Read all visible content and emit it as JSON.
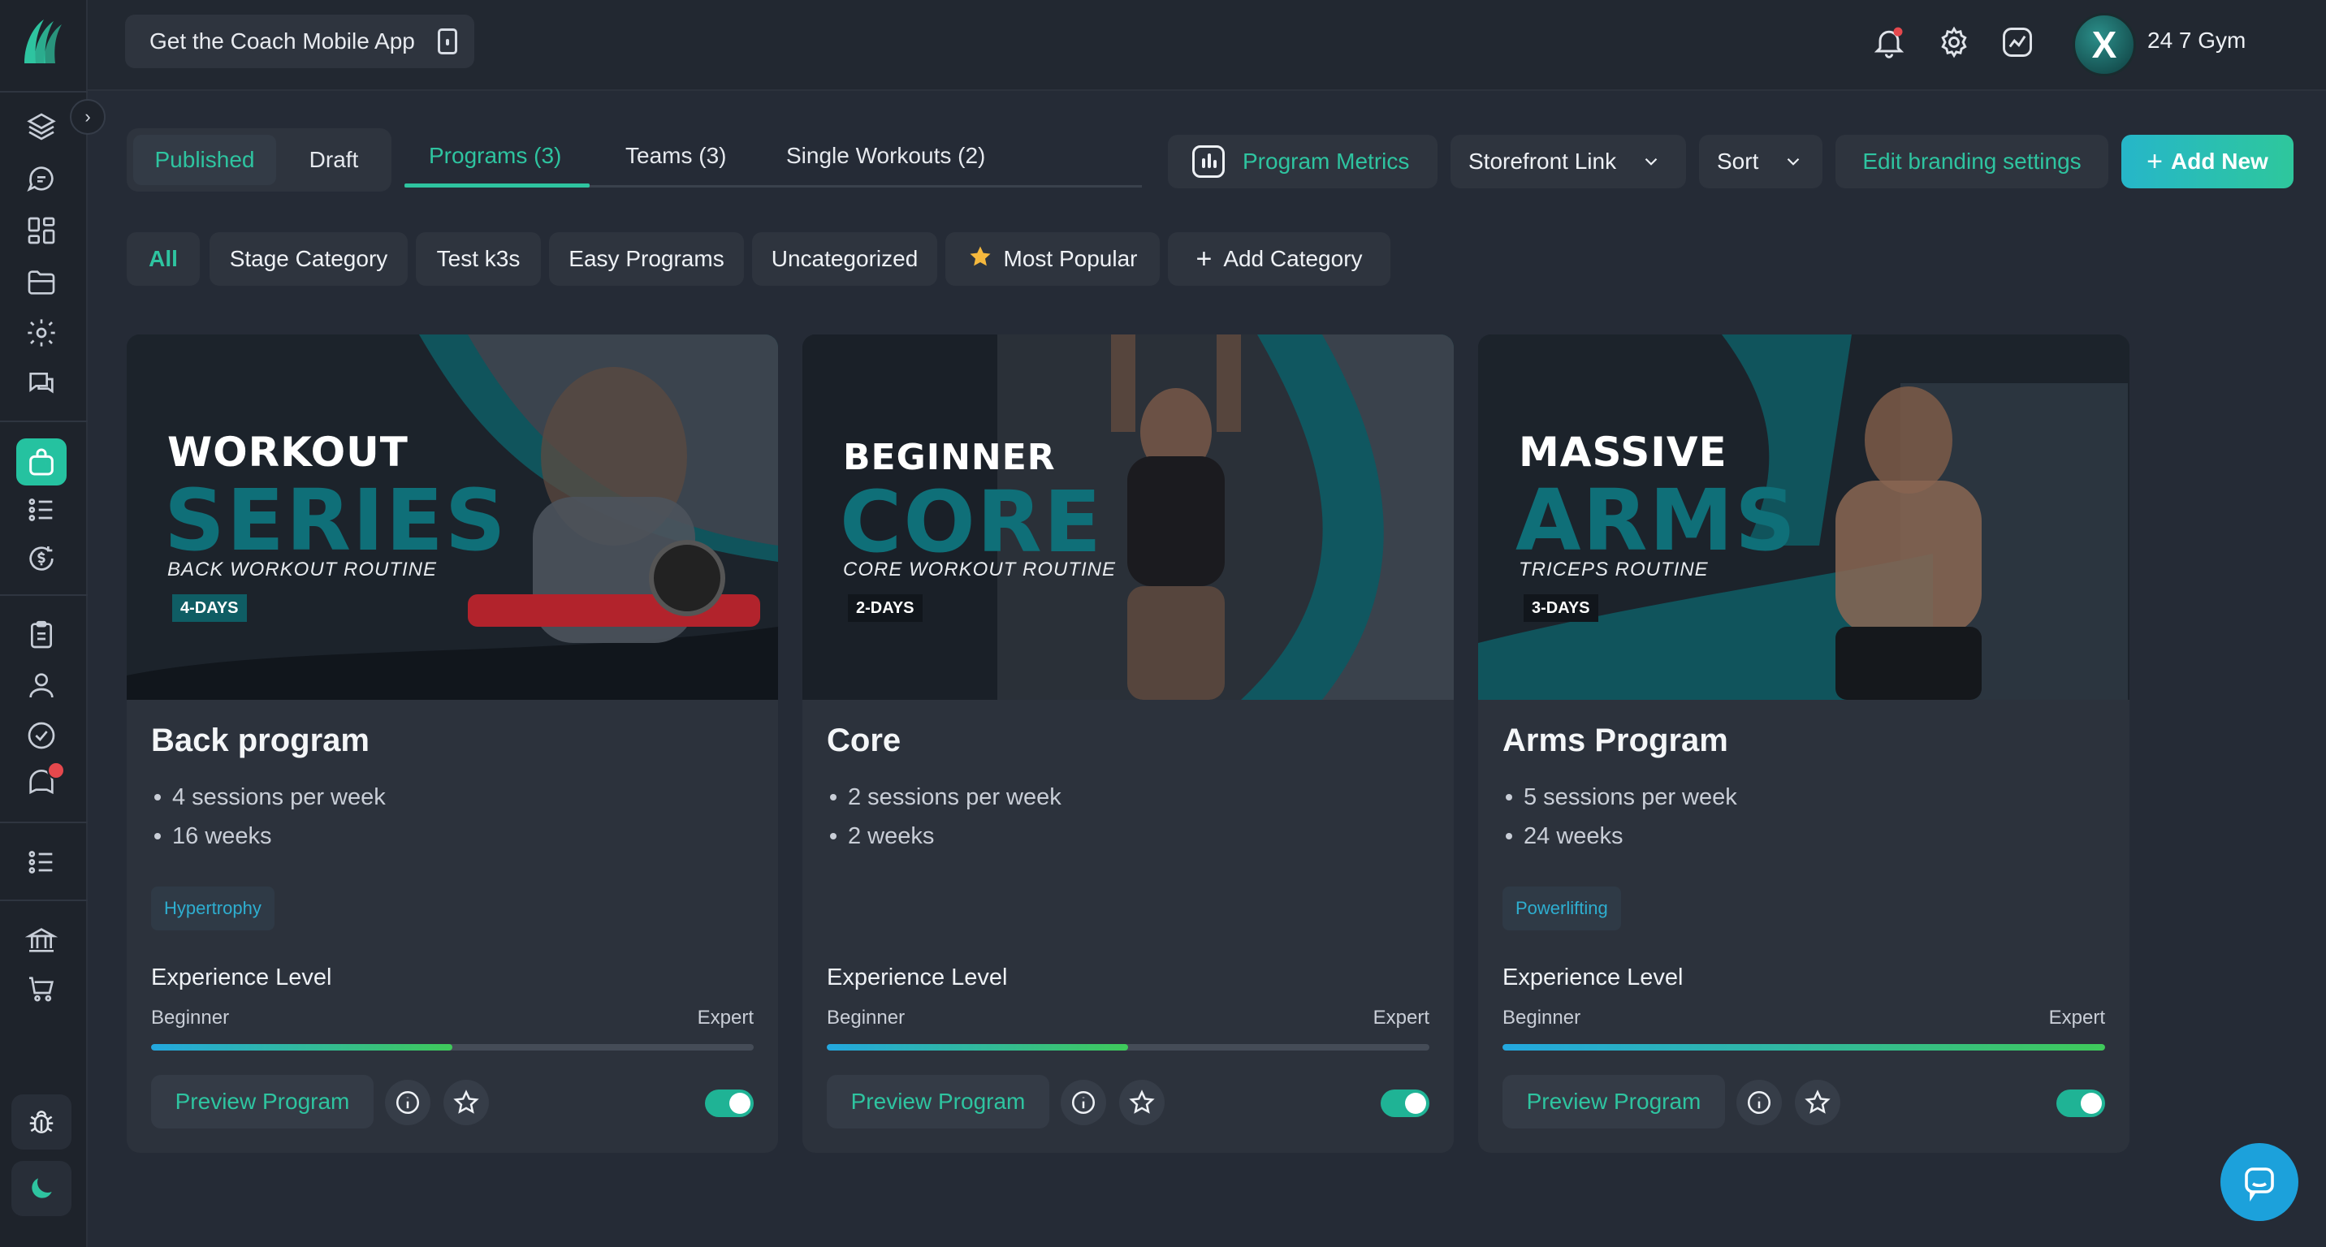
{
  "colors": {
    "accent": "#2ec4a0",
    "brand_blue": "#1ca1db",
    "bg": "#252b36",
    "card": "#2c323c"
  },
  "sidebar": {
    "logo": "leaf-logo-icon",
    "icons": [
      "layers-icon",
      "chat-icon",
      "grid-icon",
      "folder-icon",
      "gear-icon",
      "comments-icon",
      "shop-bag-icon",
      "list-icon",
      "dollar-refresh-icon",
      "clipboard-icon",
      "user-icon",
      "check-circle-icon",
      "bell-chat-icon",
      "list-alt-icon",
      "bank-icon",
      "cart-icon",
      "bug-icon",
      "moon-icon"
    ]
  },
  "topbar": {
    "coach_app_label": "Get the Coach Mobile App",
    "gym_name": "24 7 Gym",
    "avatar_letter": "X"
  },
  "status": {
    "published": "Published",
    "draft": "Draft"
  },
  "tabs": [
    {
      "label": "Programs (3)"
    },
    {
      "label": "Teams (3)"
    },
    {
      "label": "Single Workouts (2)"
    }
  ],
  "toolbar": {
    "metrics": "Program Metrics",
    "storefront": "Storefront Link",
    "sort": "Sort",
    "branding": "Edit branding settings",
    "add_new": "Add New"
  },
  "categories": [
    {
      "label": "All"
    },
    {
      "label": "Stage Category"
    },
    {
      "label": "Test k3s"
    },
    {
      "label": "Easy Programs"
    },
    {
      "label": "Uncategorized"
    },
    {
      "label": "Most Popular"
    },
    {
      "label": "Add Category"
    }
  ],
  "programs": [
    {
      "image": {
        "line1": "WORKOUT",
        "line2": "SERIES",
        "subtitle": "BACK WORKOUT ROUTINE",
        "days": "4-DAYS"
      },
      "title": "Back program",
      "bullets": [
        "4 sessions per week",
        "16 weeks"
      ],
      "tag": "Hypertrophy",
      "experience_label": "Experience Level",
      "min": "Beginner",
      "max": "Expert",
      "level_fraction": 0.5,
      "preview": "Preview Program",
      "enabled": true
    },
    {
      "image": {
        "line1": "BEGINNER",
        "line2": "CORE",
        "subtitle": "CORE WORKOUT ROUTINE",
        "days": "2-DAYS"
      },
      "title": "Core",
      "bullets": [
        "2 sessions per week",
        "2 weeks"
      ],
      "tag": "",
      "experience_label": "Experience Level",
      "min": "Beginner",
      "max": "Expert",
      "level_fraction": 0.5,
      "preview": "Preview Program",
      "enabled": true
    },
    {
      "image": {
        "line1": "MASSIVE",
        "line2": "ARMS",
        "subtitle": "TRICEPS ROUTINE",
        "days": "3-DAYS"
      },
      "title": "Arms Program",
      "bullets": [
        "5 sessions per week",
        "24 weeks"
      ],
      "tag": "Powerlifting",
      "experience_label": "Experience Level",
      "min": "Beginner",
      "max": "Expert",
      "level_fraction": 1.0,
      "preview": "Preview Program",
      "enabled": true
    }
  ]
}
